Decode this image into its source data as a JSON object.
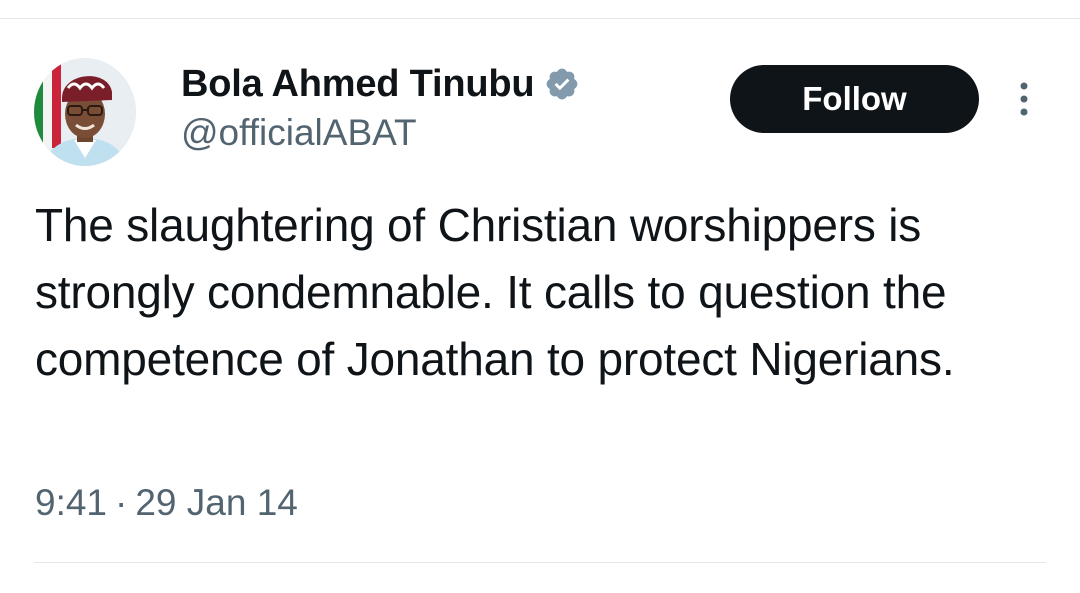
{
  "tweet": {
    "author": {
      "display_name": "Bola Ahmed Tinubu",
      "handle": "@officialABAT",
      "verified": true,
      "avatar_icon": "profile-photo"
    },
    "follow_label": "Follow",
    "more_icon": "more-vertical-icon",
    "text": "The slaughtering of Christian worshippers is strongly condemnable. It calls to question the competence of Jonathan to protect Nigerians.",
    "time": "9:41",
    "separator": "·",
    "date": "29 Jan 14"
  },
  "colors": {
    "text_primary": "#0f1419",
    "text_secondary": "#536471",
    "follow_bg": "#0f1419",
    "follow_text": "#ffffff",
    "verified_badge": "#829aab",
    "divider": "#e4e7ea"
  }
}
